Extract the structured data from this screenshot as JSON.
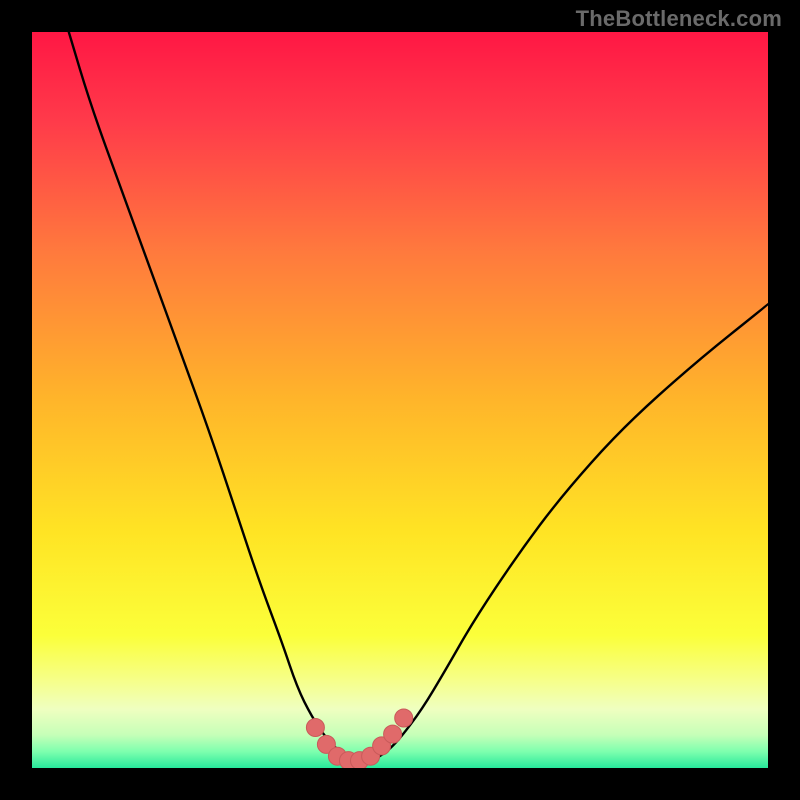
{
  "watermark": "TheBottleneck.com",
  "colors": {
    "frame": "#000000",
    "gradient_stops": [
      {
        "offset": 0.0,
        "color": "#ff1744"
      },
      {
        "offset": 0.12,
        "color": "#ff3a4a"
      },
      {
        "offset": 0.3,
        "color": "#ff7a3d"
      },
      {
        "offset": 0.5,
        "color": "#ffb52a"
      },
      {
        "offset": 0.68,
        "color": "#ffe424"
      },
      {
        "offset": 0.82,
        "color": "#fbff3a"
      },
      {
        "offset": 0.88,
        "color": "#f6ff88"
      },
      {
        "offset": 0.92,
        "color": "#efffc0"
      },
      {
        "offset": 0.955,
        "color": "#c6ffb8"
      },
      {
        "offset": 0.978,
        "color": "#7dffae"
      },
      {
        "offset": 1.0,
        "color": "#27e89b"
      }
    ],
    "curve": "#000000",
    "marker_fill": "#e06a6a",
    "marker_stroke": "#c95a5a"
  },
  "chart_data": {
    "type": "line",
    "title": "",
    "xlabel": "",
    "ylabel": "",
    "xlim": [
      0,
      100
    ],
    "ylim": [
      0,
      100
    ],
    "grid": false,
    "legend": false,
    "series": [
      {
        "name": "bottleneck-curve",
        "x": [
          5,
          8,
          12,
          16,
          20,
          24,
          28,
          31,
          34,
          36,
          38,
          40,
          42,
          44,
          46,
          48,
          50,
          53,
          56,
          60,
          66,
          72,
          80,
          90,
          100
        ],
        "y": [
          100,
          90,
          79,
          68,
          57,
          46,
          34,
          25,
          17,
          11,
          7,
          4,
          2,
          1,
          1,
          2,
          4,
          8,
          13,
          20,
          29,
          37,
          46,
          55,
          63
        ]
      }
    ],
    "markers": {
      "name": "highlight-region",
      "x": [
        38.5,
        40,
        41.5,
        43,
        44.5,
        46,
        47.5,
        49,
        50.5
      ],
      "y": [
        5.5,
        3.2,
        1.6,
        1.0,
        1.0,
        1.6,
        3.0,
        4.6,
        6.8
      ]
    }
  }
}
